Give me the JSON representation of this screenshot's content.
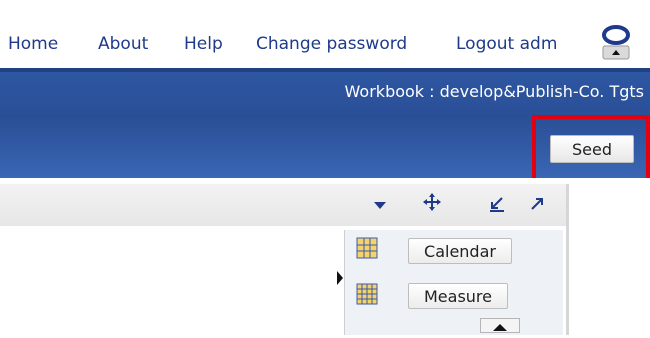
{
  "nav": {
    "links": [
      "Home",
      "About",
      "Help",
      "Change password",
      "Logout adm"
    ]
  },
  "banner": {
    "workbook_title": "Workbook : develop&Publish-Co. Tgts"
  },
  "actions": {
    "seed_label": "Seed"
  },
  "sidepane": {
    "calendar_label": "Calendar",
    "measure_label": "Measure"
  },
  "colors": {
    "banner_blue": "#2e57a3",
    "link_blue": "#1f3a8a",
    "highlight_red": "#e3000f"
  },
  "icons": [
    "oracle-logo-icon",
    "dropdown-icon",
    "move-icon",
    "minimize-icon",
    "maximize-icon",
    "grid-icon",
    "scroll-up-icon"
  ]
}
